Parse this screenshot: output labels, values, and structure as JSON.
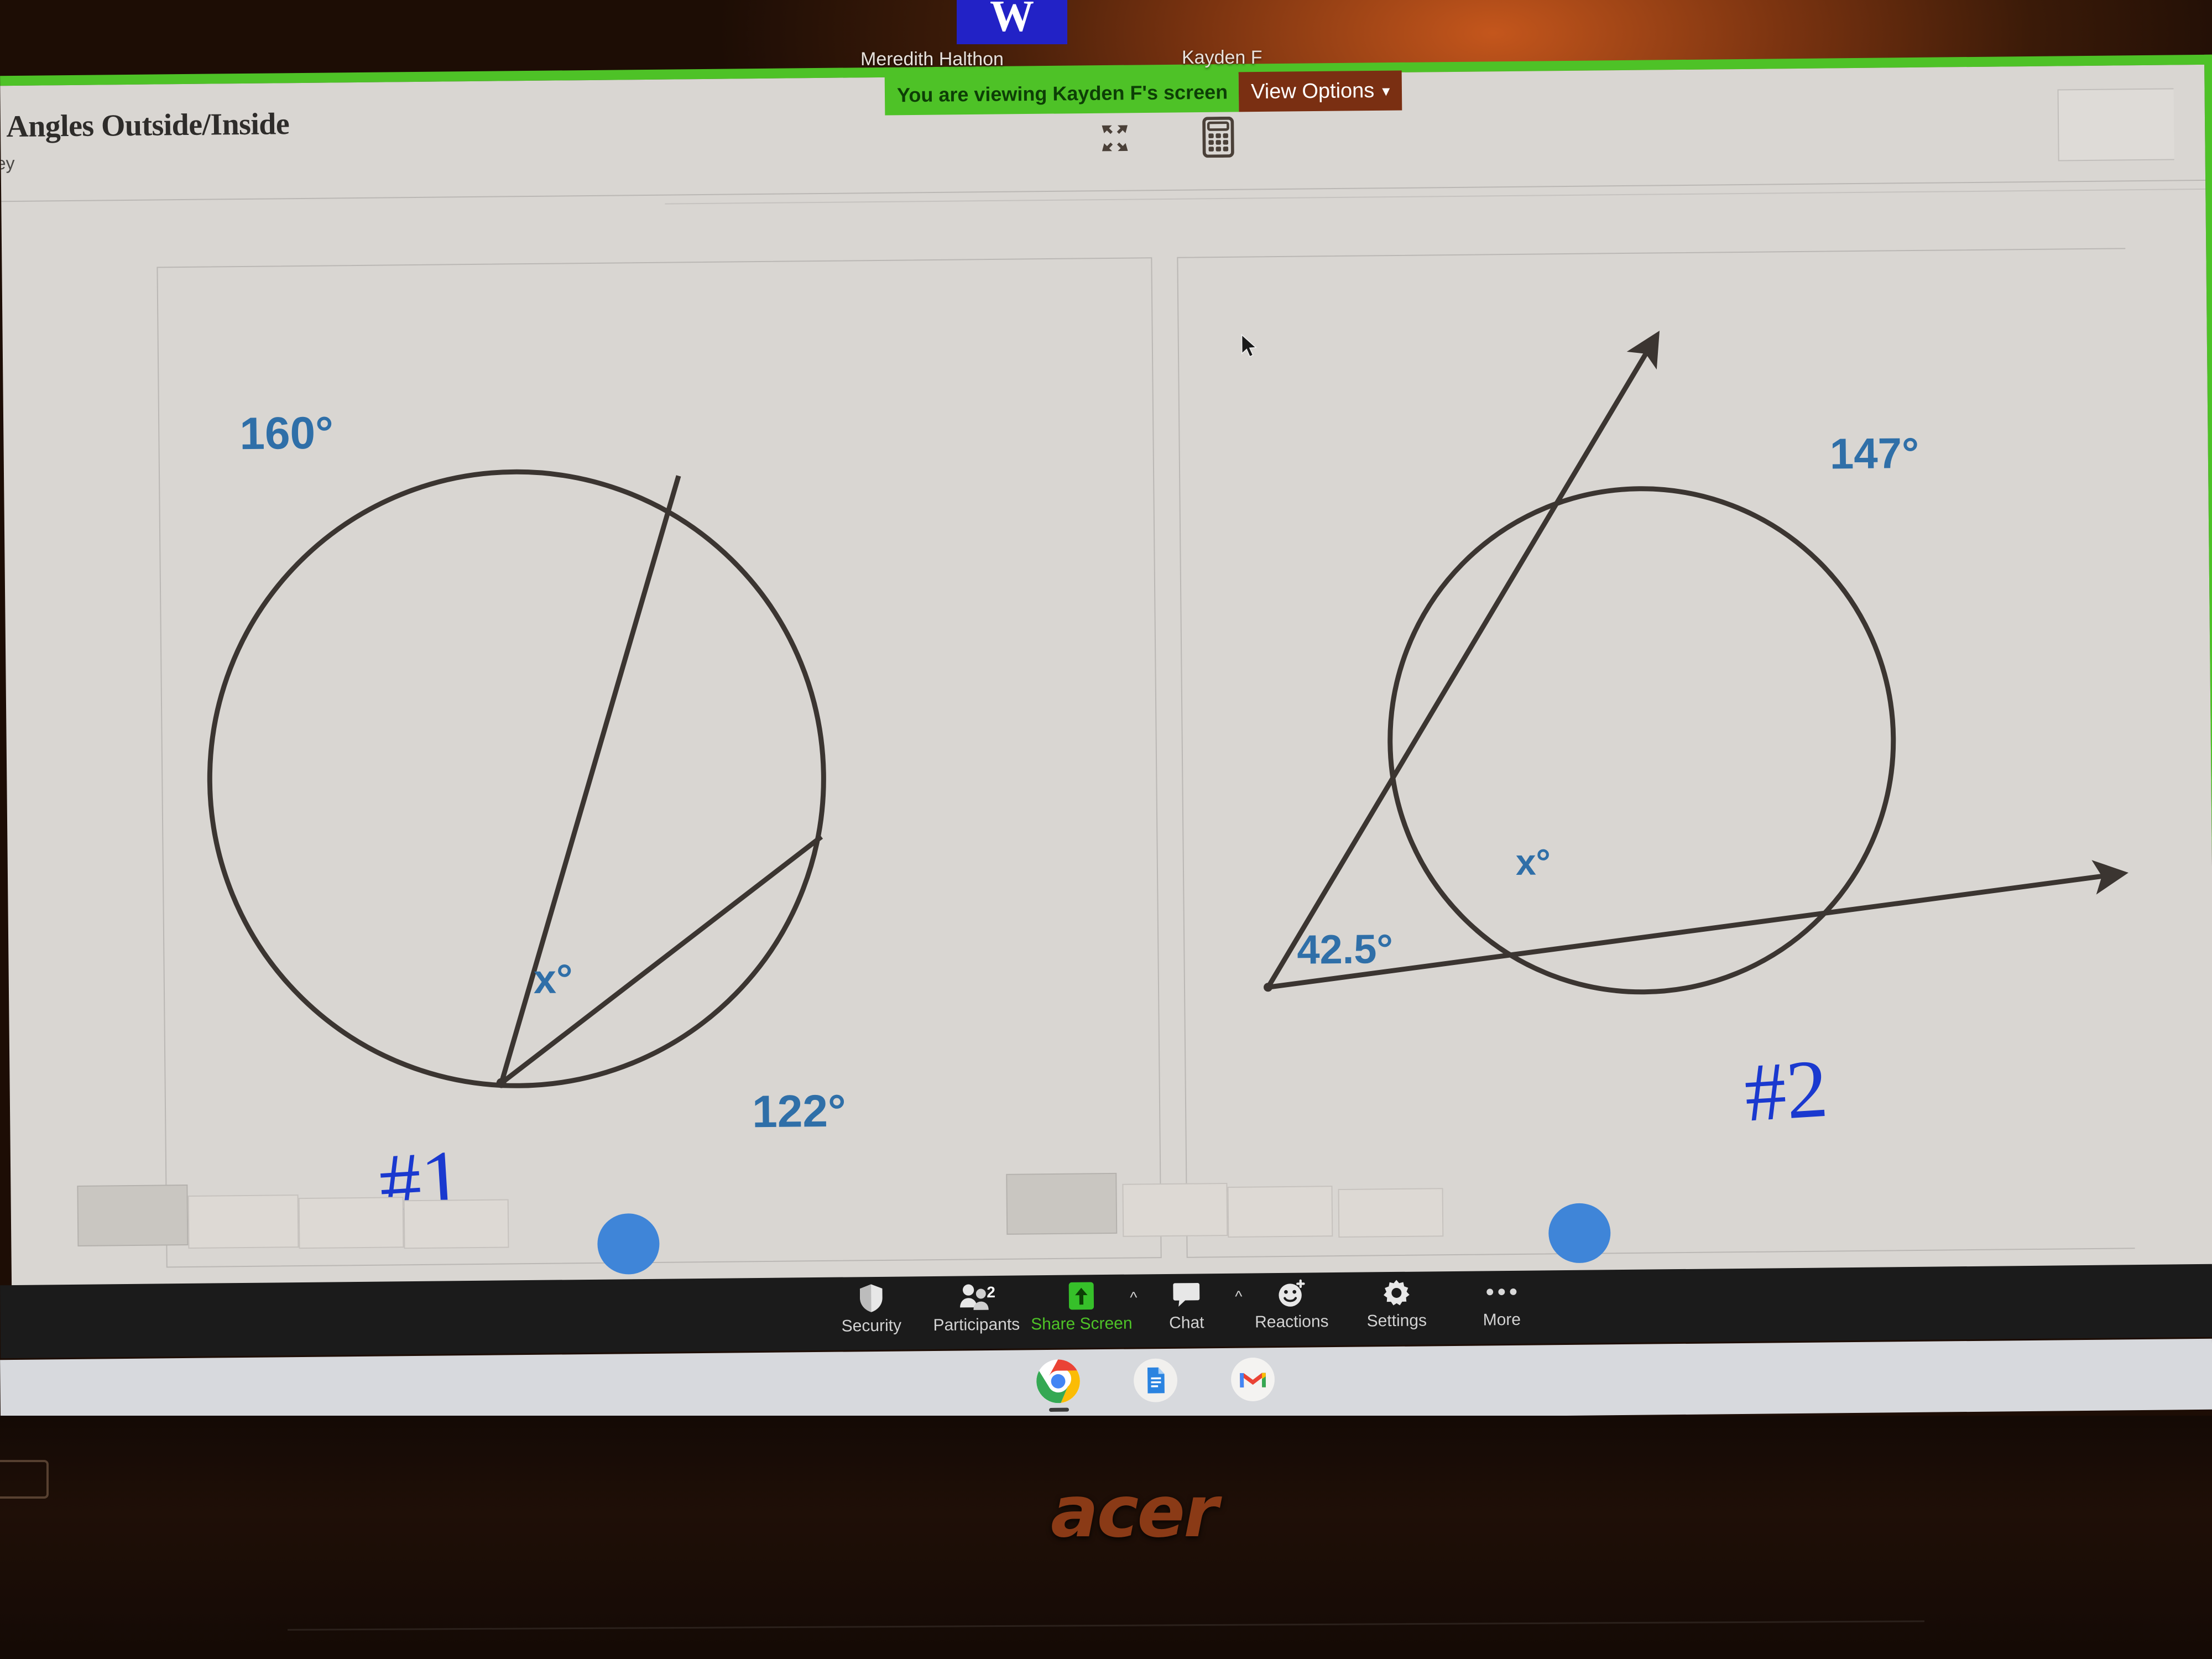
{
  "meeting": {
    "viewing_banner": "You are viewing Kayden F's screen",
    "view_options_label": "View Options",
    "view_options_chevron": "chevron-down",
    "participants": [
      {
        "name": "Meredith Halthon"
      },
      {
        "name": "Kayden F"
      }
    ],
    "video_tile_initial": "W",
    "toolbar_icons": [
      {
        "name": "fullscreen-icon",
        "title": "Enter Full Screen"
      },
      {
        "name": "calculator-icon",
        "title": "Calculator"
      }
    ],
    "controls": [
      {
        "label": "Security",
        "icon": "shield-icon",
        "active": false,
        "caret": false,
        "badge": ""
      },
      {
        "label": "Participants",
        "icon": "participants-icon",
        "active": false,
        "caret": false,
        "badge": "2"
      },
      {
        "label": "Share Screen",
        "icon": "share-screen-icon",
        "active": true,
        "caret": true,
        "badge": ""
      },
      {
        "label": "Chat",
        "icon": "chat-icon",
        "active": false,
        "caret": true,
        "badge": ""
      },
      {
        "label": "Reactions",
        "icon": "reactions-icon",
        "active": false,
        "caret": false,
        "badge": ""
      },
      {
        "label": "Settings",
        "icon": "gear-icon",
        "active": false,
        "caret": false,
        "badge": ""
      },
      {
        "label": "More",
        "icon": "more-ellipsis-icon",
        "active": false,
        "caret": false,
        "badge": ""
      }
    ]
  },
  "document": {
    "title": "- Angles Outside/Inside",
    "subtitle": "ley"
  },
  "shelf": {
    "icons": [
      {
        "name": "chrome-icon",
        "label": "Google Chrome"
      },
      {
        "name": "google-docs-icon",
        "label": "Google Docs"
      },
      {
        "name": "gmail-icon",
        "label": "Gmail"
      }
    ]
  },
  "device": {
    "brand_logo": "acer"
  },
  "chart_data": [
    {
      "type": "diagram",
      "id": "problem-1",
      "title": "#1",
      "description": "Circle with two chords meeting at a point on the circle (inscribed angle formed by two chords at a common endpoint on the circle).",
      "handwritten_label": "#1",
      "annotations": [
        {
          "text": "160°",
          "value": 160,
          "role": "arc-measure",
          "position": "upper-left"
        },
        {
          "text": "x°",
          "value": null,
          "role": "unknown-angle",
          "position": "at-vertex-inside"
        },
        {
          "text": "122°",
          "value": 122,
          "role": "arc-measure",
          "position": "lower-right"
        }
      ],
      "label_color": "#2f6fa8",
      "stroke_color": "#3b3531"
    },
    {
      "type": "diagram",
      "id": "problem-2",
      "title": "#2",
      "description": "Two secant rays drawn from an external point intersecting a circle; the exterior angle is 42.5°, the far arc is 147°, and the near arc is labeled x°.",
      "handwritten_label": "#2",
      "annotations": [
        {
          "text": "147°",
          "value": 147,
          "role": "far-arc-measure",
          "position": "upper-right"
        },
        {
          "text": "x°",
          "value": null,
          "role": "unknown-near-arc",
          "position": "inside-left"
        },
        {
          "text": "42.5°",
          "value": 42.5,
          "role": "exterior-angle",
          "position": "lower-left-vertex"
        }
      ],
      "label_color": "#2f6fa8",
      "stroke_color": "#3b3531"
    }
  ],
  "colors": {
    "share_green": "#4ec227",
    "banner_text": "#0d3f06",
    "view_options_bg": "#7a2f12",
    "annotation_blue": "#2f6fa8",
    "marker_blue": "#1a39cf",
    "acer_orange": "#8a3a16",
    "toolbar_bg": "#1b1b1b",
    "shelf_bg": "#d7d9dd",
    "page_bg": "#d9d6d2"
  }
}
